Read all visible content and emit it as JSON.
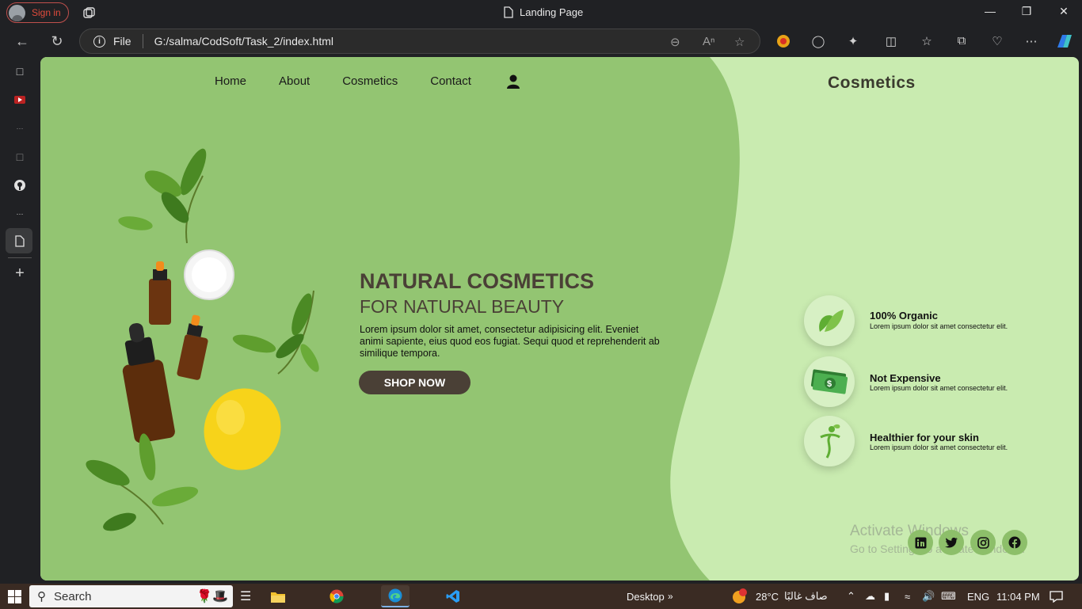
{
  "browser": {
    "signin_label": "Sign in",
    "tab_title": "Landing Page",
    "address_scheme": "File",
    "address_url": "G:/salma/CodSoft/Task_2/index.html"
  },
  "site": {
    "nav": [
      "Home",
      "About",
      "Cosmetics",
      "Contact"
    ],
    "brand": "Cosmetics",
    "hero": {
      "title": "NATURAL COSMETICS",
      "subtitle": "FOR NATURAL BEAUTY",
      "text": "Lorem ipsum dolor sit amet, consectetur adipisicing elit. Eveniet animi sapiente, eius quod eos fugiat. Sequi quod et reprehenderit ab similique tempora.",
      "button": "SHOP NOW"
    },
    "features": [
      {
        "title": "100% Organic",
        "desc": "Lorem ipsum dolor sit amet consectetur elit.",
        "icon": "leaf-icon"
      },
      {
        "title": "Not Expensive",
        "desc": "Lorem ipsum dolor sit amet consectetur elit.",
        "icon": "money-icon"
      },
      {
        "title": "Healthier for your skin",
        "desc": "Lorem ipsum dolor sit amet consectetur elit.",
        "icon": "healthy-person-icon"
      }
    ],
    "social": [
      "linkedin-icon",
      "twitter-icon",
      "instagram-icon",
      "facebook-icon"
    ],
    "colors": {
      "left_bg": "#93c572",
      "right_bg": "#c9ebb0",
      "dark": "#4a4036"
    }
  },
  "watermark": {
    "line1": "Activate Windows",
    "line2": "Go to Settings to activate Windows."
  },
  "taskbar": {
    "search_placeholder": "Search",
    "desktop_label": "Desktop",
    "weather_temp": "28°C",
    "weather_text": "صاف غالبًا",
    "lang": "ENG",
    "time": "11:04 PM",
    "notification_count": "1"
  }
}
